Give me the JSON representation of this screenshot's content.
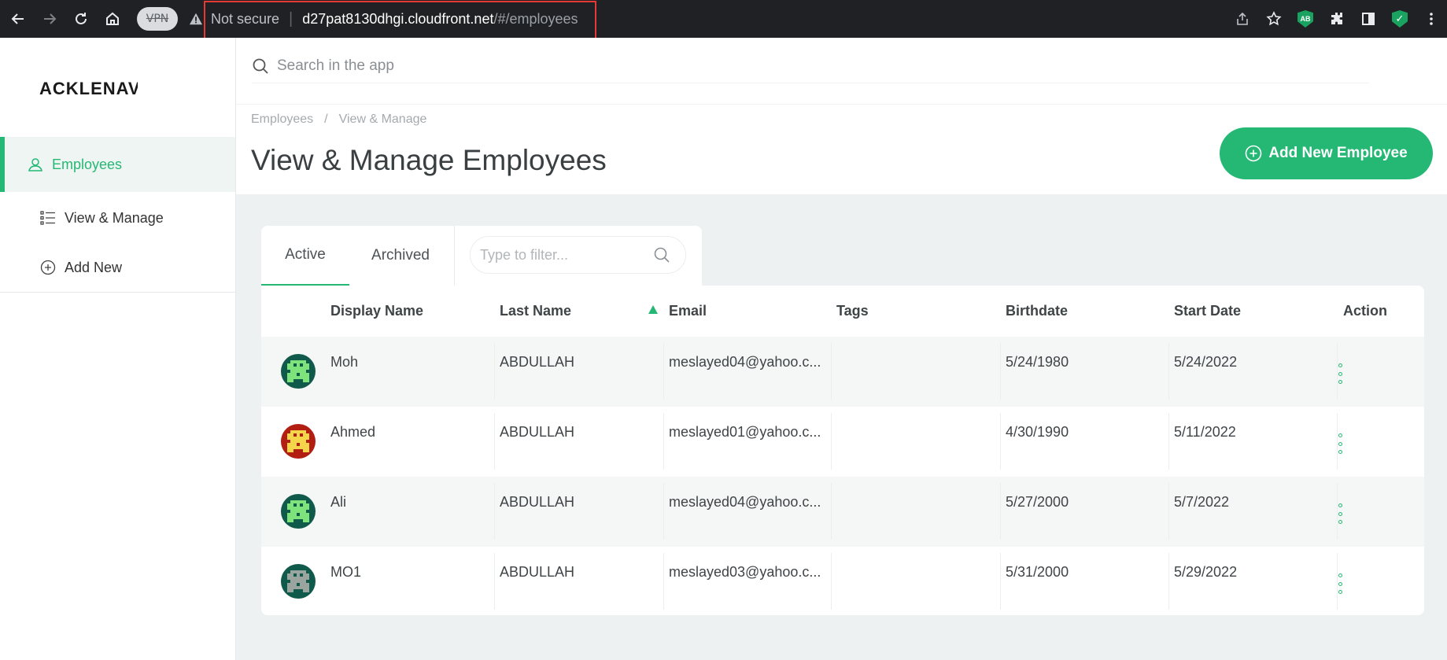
{
  "browser": {
    "vpn_label": "VPN",
    "not_secure": "Not secure",
    "url_host": "d27pat8130dhgi.cloudfront.net",
    "url_path": "/#/employees",
    "extension_ab": "AB"
  },
  "sidebar": {
    "logo": "ACKLENAVE",
    "items": [
      {
        "label": "Employees",
        "icon": "user-icon",
        "active": true
      },
      {
        "label": "View & Manage",
        "icon": "list-icon"
      },
      {
        "label": "Add New",
        "icon": "plus-circle-icon"
      }
    ]
  },
  "search": {
    "placeholder": "Search in the app"
  },
  "header": {
    "breadcrumb": [
      "Employees",
      "View & Manage"
    ],
    "breadcrumb_sep": "/",
    "title": "View & Manage Employees",
    "add_button": "Add New Employee"
  },
  "tabs": {
    "active": "Active",
    "archived": "Archived"
  },
  "filter": {
    "placeholder": "Type to filter..."
  },
  "table": {
    "columns": [
      "Display Name",
      "Last Name",
      "Email",
      "Tags",
      "Birthdate",
      "Start Date",
      "Action"
    ],
    "sorted_column": "Email",
    "rows": [
      {
        "display_name": "Moh",
        "last_name": "ABDULLAH",
        "email": "meslayed04@yahoo.c...",
        "tags": "",
        "birthdate": "5/24/1980",
        "start_date": "5/24/2022",
        "avatar_bg": "#0f5a4a",
        "avatar_fg": "#7ee37a"
      },
      {
        "display_name": "Ahmed",
        "last_name": "ABDULLAH",
        "email": "meslayed01@yahoo.c...",
        "tags": "",
        "birthdate": "4/30/1990",
        "start_date": "5/11/2022",
        "avatar_bg": "#b21e12",
        "avatar_fg": "#f5d64a"
      },
      {
        "display_name": "Ali",
        "last_name": "ABDULLAH",
        "email": "meslayed04@yahoo.c...",
        "tags": "",
        "birthdate": "5/27/2000",
        "start_date": "5/7/2022",
        "avatar_bg": "#0f5a4a",
        "avatar_fg": "#7ee37a"
      },
      {
        "display_name": "MO1",
        "last_name": "ABDULLAH",
        "email": "meslayed03@yahoo.c...",
        "tags": "",
        "birthdate": "5/31/2000",
        "start_date": "5/29/2022",
        "avatar_bg": "#0f5a4a",
        "avatar_fg": "#9aa5a0"
      }
    ]
  },
  "colors": {
    "accent": "#25b874",
    "content_bg": "#eef1f1"
  }
}
